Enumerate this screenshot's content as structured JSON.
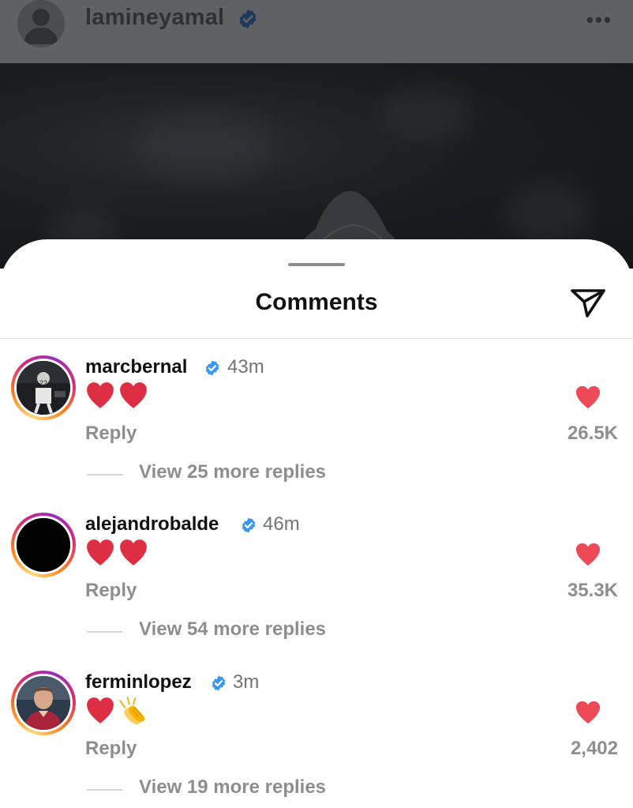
{
  "post": {
    "username": "lamineyamal",
    "more_icon": "more-horizontal-icon",
    "more_label": "•••"
  },
  "sheet": {
    "title": "Comments",
    "share_icon": "send-paper-plane-icon"
  },
  "colors": {
    "verified": "#3897f0",
    "like": "#ed4956",
    "muted_text": "#8e8e8e"
  },
  "comments": [
    {
      "username": "marcbernal",
      "verified": true,
      "time": "43m",
      "emojis": [
        "red-heart",
        "red-heart"
      ],
      "reply_label": "Reply",
      "like_count": "26.5K",
      "view_replies": "View 25 more replies"
    },
    {
      "username": "alejandrobalde",
      "verified": true,
      "time": "46m",
      "emojis": [
        "red-heart",
        "red-heart"
      ],
      "reply_label": "Reply",
      "like_count": "35.3K",
      "view_replies": "View 54 more replies"
    },
    {
      "username": "ferminlopez",
      "verified": true,
      "time": "3m",
      "emojis": [
        "red-heart",
        "clapping-hands"
      ],
      "reply_label": "Reply",
      "like_count": "2,402",
      "view_replies": "View 19 more replies"
    }
  ]
}
